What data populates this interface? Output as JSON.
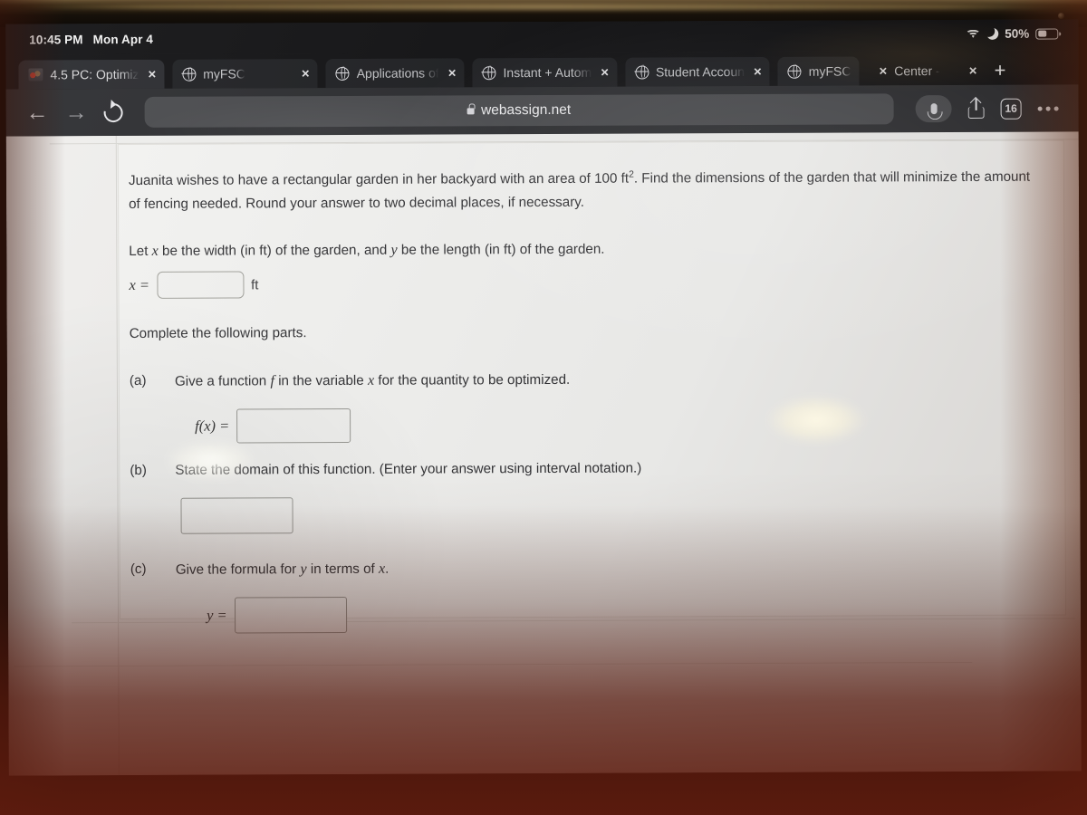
{
  "status_bar": {
    "time": "10:45 PM",
    "date": "Mon Apr 4",
    "battery_percent": "50%",
    "wifi_icon": "wifi-icon",
    "dnd_icon": "moon-icon",
    "battery_icon": "battery-icon"
  },
  "tabs": [
    {
      "label": "4.5 PC: Optimiz",
      "favicon": "pdf-favicon",
      "close": "×",
      "active": true
    },
    {
      "label": "myFSC",
      "favicon": "globe-icon",
      "close": "×",
      "active": false
    },
    {
      "label": "Applications of",
      "favicon": "globe-icon",
      "close": "×",
      "active": false
    },
    {
      "label": "Instant + Autom",
      "favicon": "globe-icon",
      "close": "×",
      "active": false
    },
    {
      "label": "Student Accoun",
      "favicon": "globe-icon",
      "close": "×",
      "active": false
    },
    {
      "label": "myFSC",
      "favicon": "globe-icon",
      "close": "×",
      "active": false
    },
    {
      "label": "Center -",
      "favicon": "globe-icon",
      "close": "×",
      "active": false
    }
  ],
  "new_tab_label": "+",
  "toolbar": {
    "back_icon": "←",
    "forward_icon": "→",
    "reload_icon": "reload-icon",
    "url": "webassign.net",
    "lock_icon": "lock-icon",
    "mic_icon": "microphone-icon",
    "share_icon": "share-icon",
    "tab_count": "16",
    "more_icon": "more-options-icon"
  },
  "problem": {
    "statement_part1": "Juanita wishes to have a rectangular garden in her backyard with an area of 100 ft",
    "statement_exponent": "2",
    "statement_part2": ". Find the dimensions of the garden that will minimize the amount of fencing needed. Round your answer to two decimal places, if necessary.",
    "definition_line": {
      "seg1": "Let ",
      "var_x": "x",
      "seg2": " be the width (in ft) of the garden, and ",
      "var_y": "y",
      "seg3": " be the length (in ft) of the garden."
    },
    "x_label": "x =",
    "x_value": "",
    "x_unit": "ft",
    "instruction": "Complete the following parts.",
    "parts": [
      {
        "tag": "(a)",
        "seg1": "Give a function ",
        "var1": "f",
        "seg2": " in the variable ",
        "var2": "x",
        "seg3": " for the quantity to be optimized.",
        "answer_label": "f(x) =",
        "answer_value": ""
      },
      {
        "tag": "(b)",
        "text": "State the domain of this function. (Enter your answer using interval notation.)",
        "answer_label": "",
        "answer_value": ""
      },
      {
        "tag": "(c)",
        "seg1": "Give the formula for ",
        "var1": "y",
        "seg2": " in terms of ",
        "var2": "x",
        "seg3": ".",
        "answer_label": "y =",
        "answer_value": ""
      }
    ]
  },
  "colors": {
    "chrome_bg": "#2d2e31",
    "tabstrip_bg": "#131315",
    "page_bg": "#efefed",
    "text": "#333336",
    "input_border": "#9a9a95",
    "desk": "#5c1c0c"
  }
}
